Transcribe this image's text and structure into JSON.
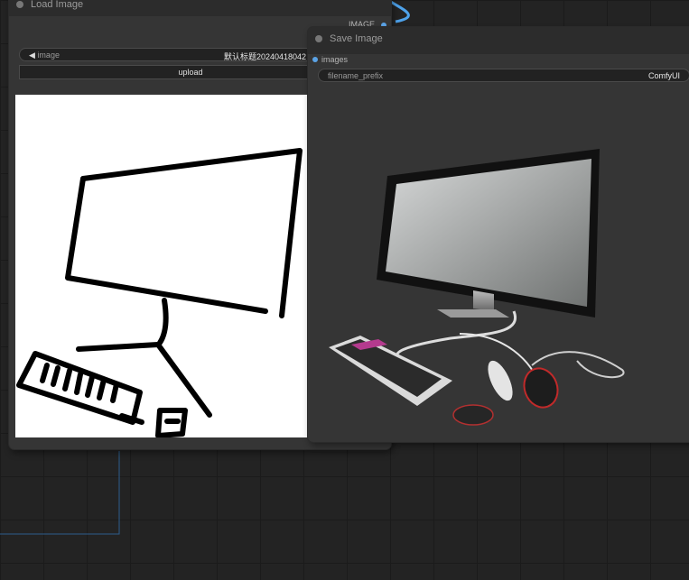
{
  "load_image": {
    "title": "Load Image",
    "output_label": "IMAGE",
    "image_widget": {
      "arrow": "◀",
      "name": "image",
      "value": "默认标题20240418042"
    },
    "upload_label": "upload",
    "preview_icon": "sketch-of-computer-icon"
  },
  "save_image": {
    "title": "Save Image",
    "input_label": "images",
    "prefix_widget": {
      "name": "filename_prefix",
      "value": "ComfyUI"
    },
    "preview_icon": "rendered-computer-icon"
  },
  "colors": {
    "link": "#5ba3e6",
    "node_bg": "#353535",
    "canvas": "#232323"
  }
}
